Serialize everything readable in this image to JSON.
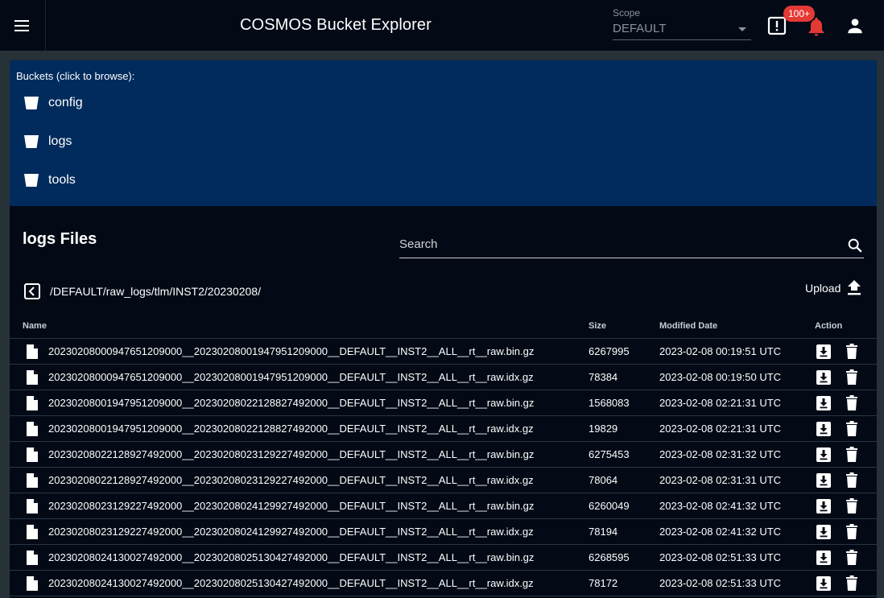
{
  "app": {
    "title": "COSMOS Bucket Explorer",
    "scope_label": "Scope",
    "scope_value": "DEFAULT",
    "notifications_badge": "100+",
    "icons": {
      "menu": "menu-icon",
      "alert": "alert-box-icon",
      "bell": "bell-icon",
      "user": "account-icon"
    }
  },
  "buckets": {
    "heading": "Buckets (click to browse):",
    "items": [
      {
        "label": "config",
        "icon": "bucket-icon"
      },
      {
        "label": "logs",
        "icon": "bucket-icon"
      },
      {
        "label": "tools",
        "icon": "bucket-icon"
      }
    ]
  },
  "files": {
    "title": "logs Files",
    "search_label": "Search",
    "path": "/DEFAULT/raw_logs/tlm/INST2/20230208/",
    "upload_label": "Upload",
    "columns": {
      "name": "Name",
      "size": "Size",
      "modified": "Modified Date",
      "action": "Action"
    },
    "rows": [
      {
        "name": "20230208000947651209000__20230208001947951209000__DEFAULT__INST2__ALL__rt__raw.bin.gz",
        "size": "6267995",
        "modified": "2023-02-08 00:19:51 UTC"
      },
      {
        "name": "20230208000947651209000__20230208001947951209000__DEFAULT__INST2__ALL__rt__raw.idx.gz",
        "size": "78384",
        "modified": "2023-02-08 00:19:50 UTC"
      },
      {
        "name": "20230208001947951209000__20230208022128827492000__DEFAULT__INST2__ALL__rt__raw.bin.gz",
        "size": "1568083",
        "modified": "2023-02-08 02:21:31 UTC"
      },
      {
        "name": "20230208001947951209000__20230208022128827492000__DEFAULT__INST2__ALL__rt__raw.idx.gz",
        "size": "19829",
        "modified": "2023-02-08 02:21:31 UTC"
      },
      {
        "name": "20230208022128927492000__20230208023129227492000__DEFAULT__INST2__ALL__rt__raw.bin.gz",
        "size": "6275453",
        "modified": "2023-02-08 02:31:32 UTC"
      },
      {
        "name": "20230208022128927492000__20230208023129227492000__DEFAULT__INST2__ALL__rt__raw.idx.gz",
        "size": "78064",
        "modified": "2023-02-08 02:31:31 UTC"
      },
      {
        "name": "20230208023129227492000__20230208024129927492000__DEFAULT__INST2__ALL__rt__raw.bin.gz",
        "size": "6260049",
        "modified": "2023-02-08 02:41:32 UTC"
      },
      {
        "name": "20230208023129227492000__20230208024129927492000__DEFAULT__INST2__ALL__rt__raw.idx.gz",
        "size": "78194",
        "modified": "2023-02-08 02:41:32 UTC"
      },
      {
        "name": "20230208024130027492000__20230208025130427492000__DEFAULT__INST2__ALL__rt__raw.bin.gz",
        "size": "6268595",
        "modified": "2023-02-08 02:51:33 UTC"
      },
      {
        "name": "20230208024130027492000__20230208025130427492000__DEFAULT__INST2__ALL__rt__raw.idx.gz",
        "size": "78172",
        "modified": "2023-02-08 02:51:33 UTC"
      }
    ]
  }
}
